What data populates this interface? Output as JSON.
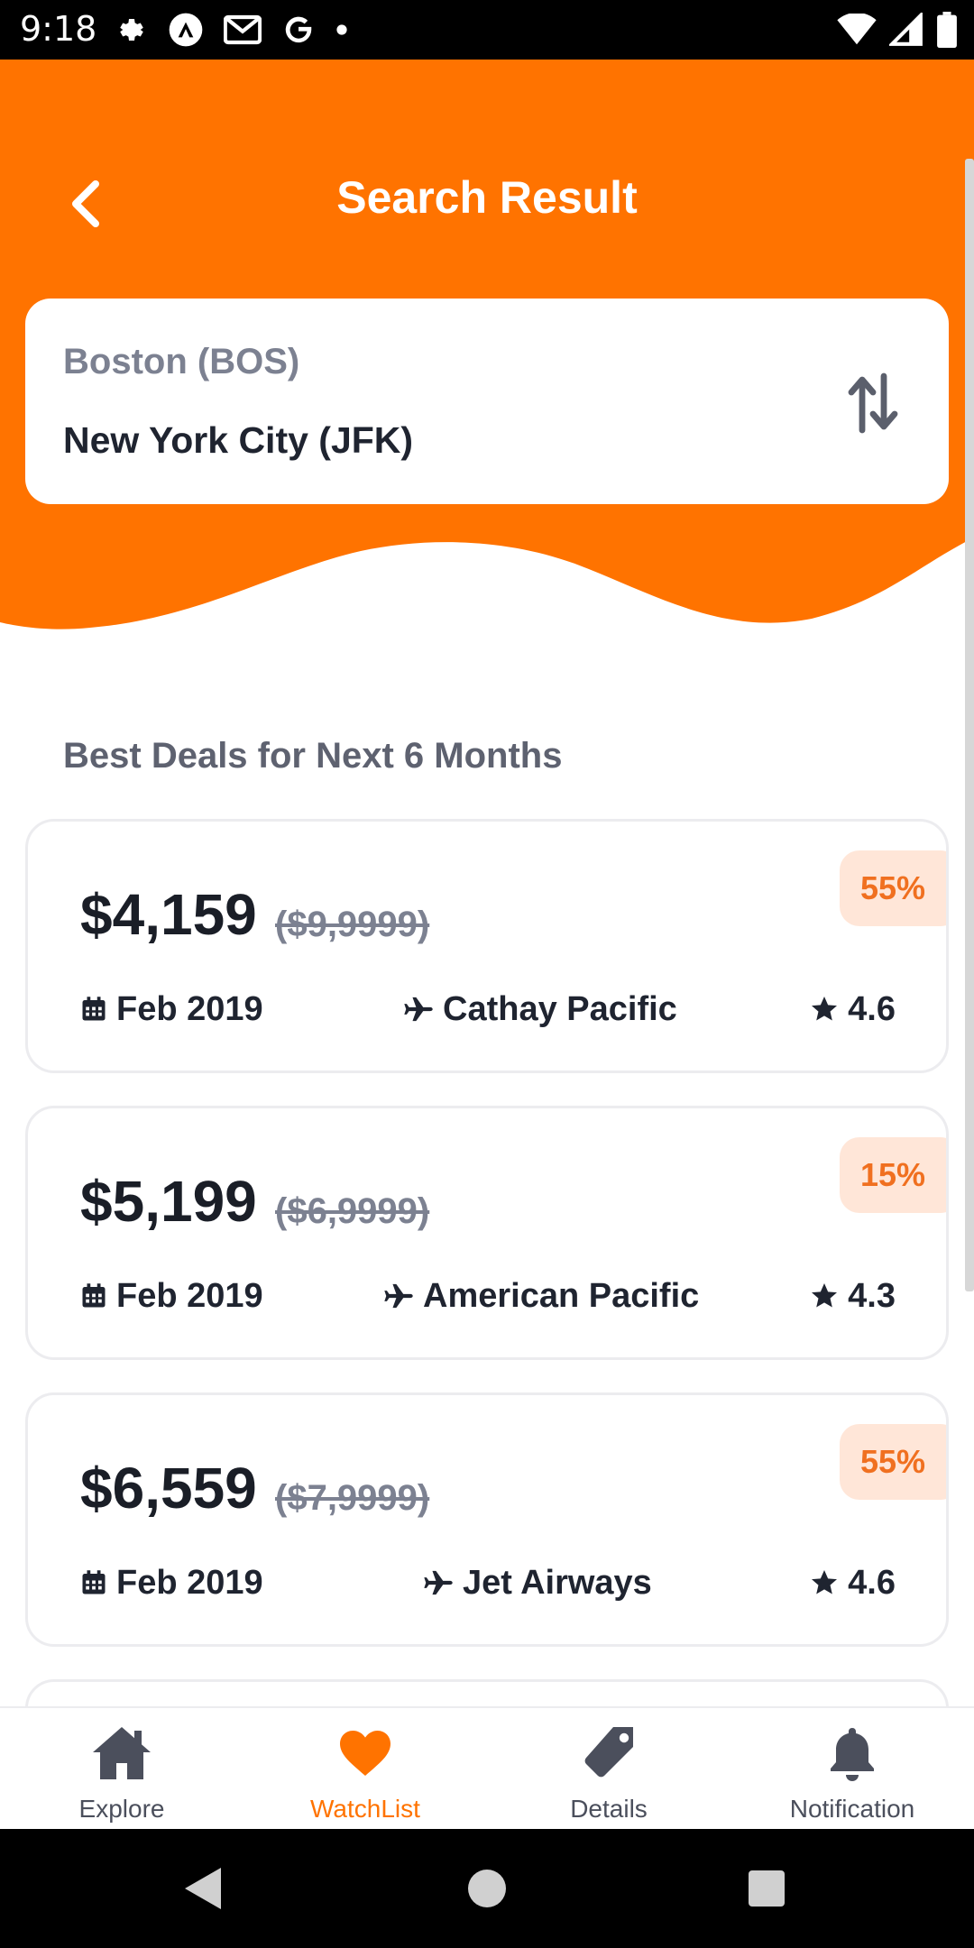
{
  "status_bar": {
    "time": "9:18"
  },
  "header": {
    "title": "Search Result",
    "accent_color": "#FF7300"
  },
  "route": {
    "from": "Boston (BOS)",
    "to": "New York City (JFK)"
  },
  "section_title": "Best Deals for Next 6 Months",
  "deals": [
    {
      "price": "$4,159",
      "old_price": "($9,9999)",
      "discount": "55%",
      "date": "Feb 2019",
      "airline": "Cathay Pacific",
      "rating": "4.6"
    },
    {
      "price": "$5,199",
      "old_price": "($6,9999)",
      "discount": "15%",
      "date": "Feb 2019",
      "airline": "American Pacific",
      "rating": "4.3"
    },
    {
      "price": "$6,559",
      "old_price": "($7,9999)",
      "discount": "55%",
      "date": "Feb 2019",
      "airline": "Jet Airways",
      "rating": "4.6"
    }
  ],
  "bottom_nav": {
    "items": [
      {
        "label": "Explore",
        "icon": "home-icon"
      },
      {
        "label": "WatchList",
        "icon": "heart-icon",
        "active": true
      },
      {
        "label": "Details",
        "icon": "tag-icon"
      },
      {
        "label": "Notification",
        "icon": "bell-icon"
      }
    ]
  }
}
